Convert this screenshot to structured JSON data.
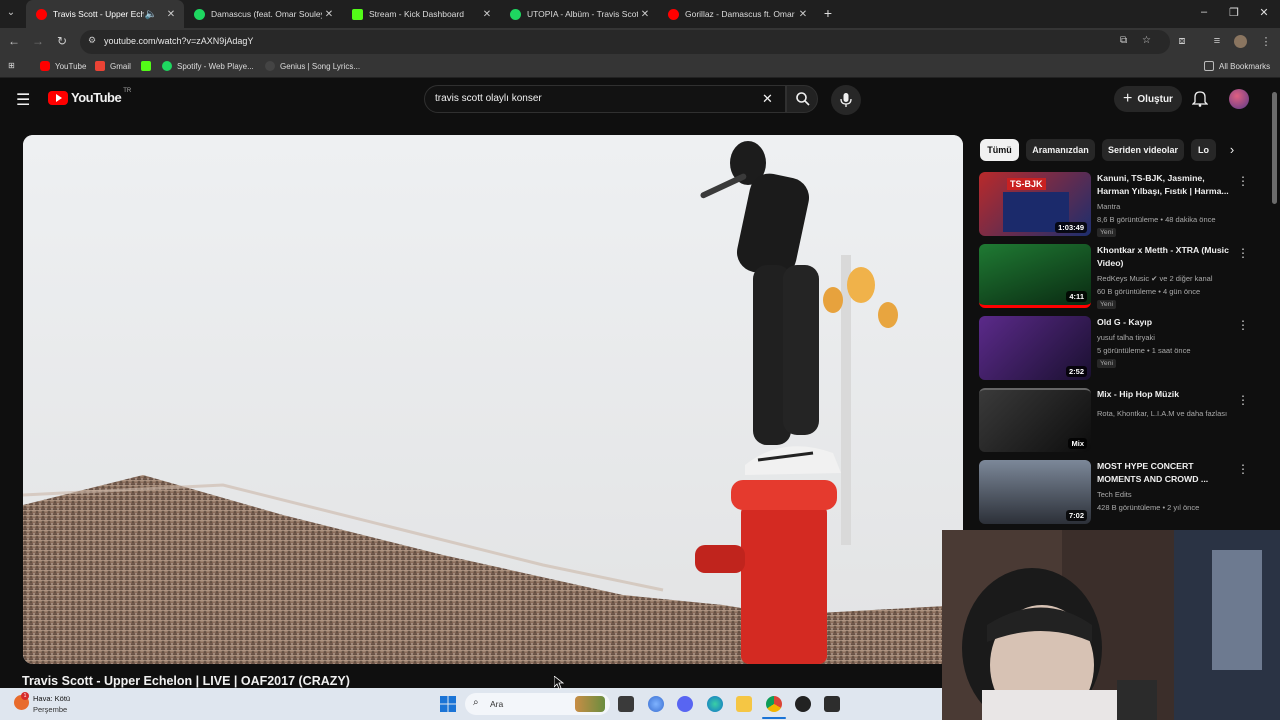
{
  "browser": {
    "tabs": [
      {
        "title": "Travis Scott - Upper Echelon",
        "color": "#ff0000",
        "active": true
      },
      {
        "title": "Damascus (feat. Omar Souleyman)",
        "color": "#1ed760",
        "active": false
      },
      {
        "title": "Stream - Kick Dashboard",
        "color": "#53fc18",
        "active": false
      },
      {
        "title": "UTOPIA - Albüm - Travis Scott |",
        "color": "#1ed760",
        "active": false
      },
      {
        "title": "Gorillaz - Damascus ft. Omar So",
        "color": "#ff0000",
        "active": false
      }
    ],
    "new_tab": "+",
    "url": "youtube.com/watch?v=zAXN9jAdagY",
    "bookmarks": [
      {
        "label": "YouTube",
        "color": "#ff0000"
      },
      {
        "label": "Gmail",
        "color": "#ea4335"
      },
      {
        "label": "",
        "color": "#53fc18"
      },
      {
        "label": "Spotify - Web Playe...",
        "color": "#1ed760"
      },
      {
        "label": "Genius | Song Lyrics...",
        "color": "#444444"
      }
    ],
    "all_bookmarks": "All Bookmarks"
  },
  "youtube": {
    "logo_text": "YouTube",
    "country": "TR",
    "search_value": "travis scott olaylı konser",
    "create_label": "Oluştur",
    "video_title": "Travis Scott - Upper Echelon | LIVE | OAF2017 (CRAZY)",
    "chips": [
      "Tümü",
      "Aramanızdan",
      "Seriden videolar",
      "Lo"
    ],
    "recommendations": [
      {
        "title": "Kanuni, TS-BJK, Jasmine, Harman Yılbaşı, Fıstık | Harma...",
        "channel": "Mantra",
        "meta": "8,6 B görüntüleme • 48 dakika önce",
        "badge": "Yeni",
        "duration": "1:03:49",
        "thumb_color": "#c9302c"
      },
      {
        "title": "Khontkar x Metth - XTRA (Music Video)",
        "channel": "RedKeys Music ✔ ve 2 diğer kanal",
        "meta": "60 B görüntüleme • 4 gün önce",
        "badge": "Yeni",
        "duration": "4:11",
        "thumb_color": "#1c6b2a"
      },
      {
        "title": "Old G - Kayıp",
        "channel": "yusuf talha tiryaki",
        "meta": "5 görüntüleme • 1 saat önce",
        "badge": "Yeni",
        "duration": "2:52",
        "thumb_color": "#3a1f6e"
      },
      {
        "title": "Mix - Hip Hop Müzik",
        "channel": "Rota, Khontkar, L.I.A.M ve daha fazlası",
        "meta": "",
        "badge": "",
        "duration": "Mix",
        "thumb_color": "#2b2b2b"
      },
      {
        "title": "MOST HYPE CONCERT MOMENTS AND CROWD ...",
        "channel": "Tech Edits",
        "meta": "428 B görüntüleme • 2 yıl önce",
        "badge": "",
        "duration": "7:02",
        "thumb_color": "#4a5566"
      }
    ]
  },
  "taskbar": {
    "weather_title": "Hava: Kötü",
    "weather_day": "Perşembe",
    "weather_badge": "1",
    "search_placeholder": "Ara"
  }
}
